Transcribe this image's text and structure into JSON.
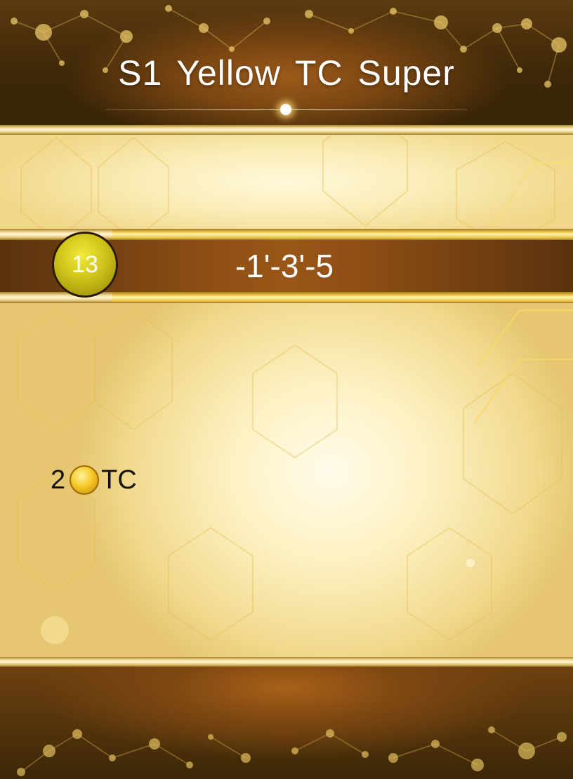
{
  "header": {
    "title": "S1 Yellow TC Super"
  },
  "level": {
    "number": "13",
    "code": "-1'-3'-5"
  },
  "reward": {
    "amount": "2",
    "icon": "gold-coin-icon",
    "unit": "TC"
  },
  "colors": {
    "gold": "#f2dc9a",
    "brown": "#8c4d14",
    "badge_yellow": "#cfc21a"
  }
}
